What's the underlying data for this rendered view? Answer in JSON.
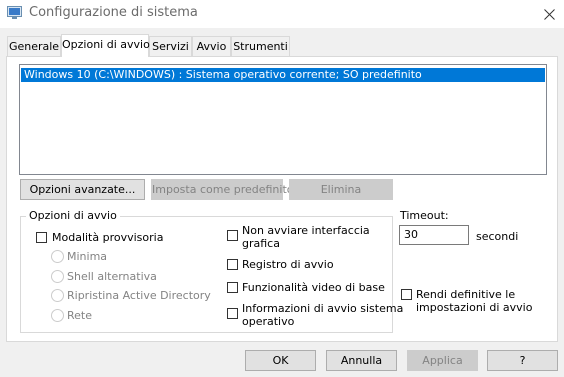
{
  "window": {
    "title": "Configurazione di sistema"
  },
  "icons": {
    "app": "msconfig-app-icon",
    "close": "close-icon"
  },
  "tabs": [
    {
      "label": "Generale"
    },
    {
      "label": "Opzioni di avvio",
      "active": true
    },
    {
      "label": "Servizi"
    },
    {
      "label": "Avvio"
    },
    {
      "label": "Strumenti"
    }
  ],
  "boot_list": {
    "items": [
      {
        "label": "Windows 10 (C:\\WINDOWS) : Sistema operativo corrente; SO predefinito",
        "selected": true
      }
    ]
  },
  "list_buttons": {
    "advanced": "Opzioni avanzate...",
    "set_default": "Imposta come predefinito",
    "delete": "Elimina"
  },
  "boot_options": {
    "legend": "Opzioni di avvio",
    "safe_boot": {
      "label": "Modalità provvisoria",
      "checked": false
    },
    "radios": [
      {
        "label": "Minima"
      },
      {
        "label": "Shell alternativa"
      },
      {
        "label": "Ripristina Active Directory"
      },
      {
        "label": "Rete"
      }
    ],
    "no_gui": {
      "label_line1": "Non avviare interfaccia",
      "label_line2": "grafica",
      "checked": false
    },
    "boot_log": {
      "label": "Registro di avvio",
      "checked": false
    },
    "base_video": {
      "label": "Funzionalità video di base",
      "checked": false
    },
    "os_boot_info": {
      "label_line1": "Informazioni di avvio sistema",
      "label_line2": "operativo",
      "checked": false
    }
  },
  "timeout": {
    "label": "Timeout:",
    "value": "30",
    "unit": "secondi"
  },
  "make_permanent": {
    "label_line1": "Rendi definitive le",
    "label_line2": "impostazioni di avvio",
    "checked": false
  },
  "dialog_buttons": {
    "ok": "OK",
    "cancel": "Annulla",
    "apply": "Applica",
    "help": "?"
  },
  "colors": {
    "selection": "#0078d7",
    "disabled_text": "#838383"
  }
}
